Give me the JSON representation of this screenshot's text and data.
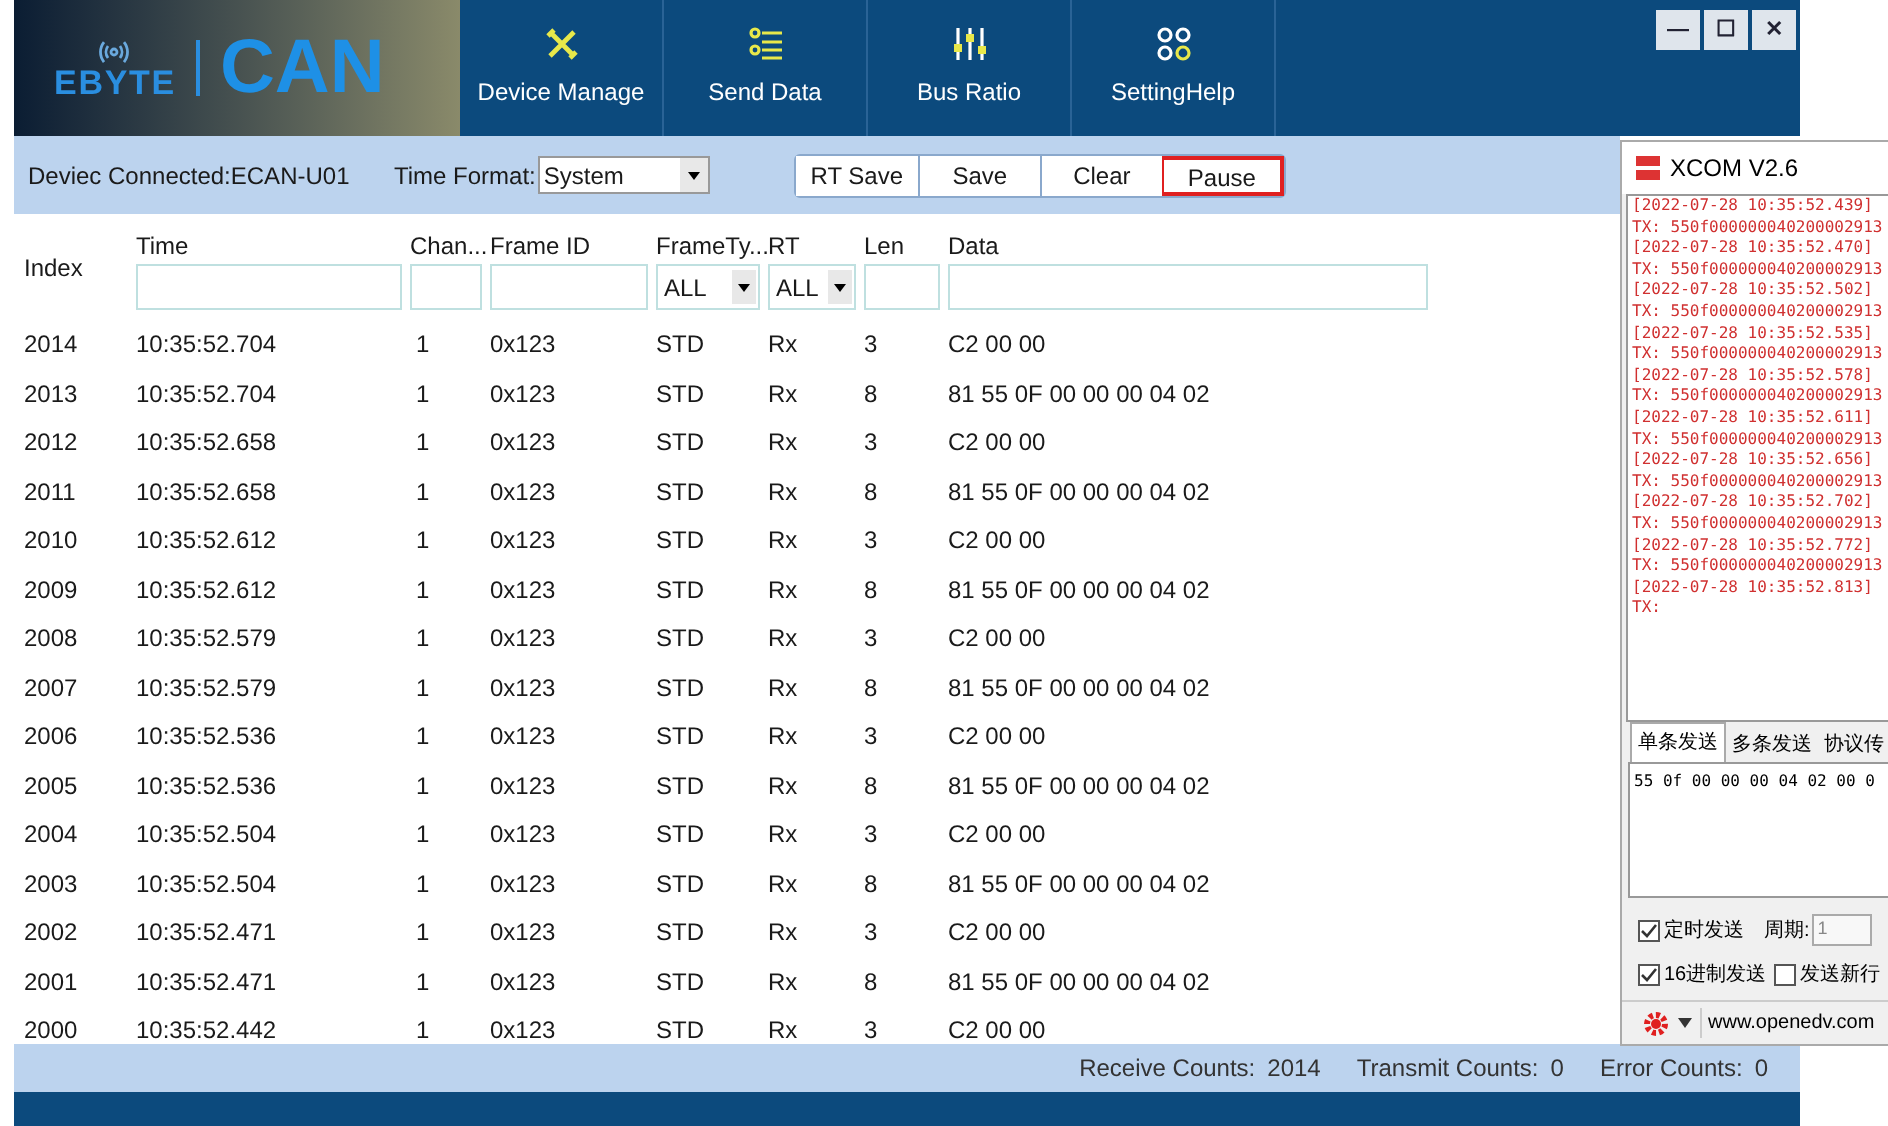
{
  "app": {
    "logo": {
      "brand": "EBYTE",
      "product": "CAN"
    },
    "nav": [
      {
        "label": "Device Manage"
      },
      {
        "label": "Send Data"
      },
      {
        "label": "Bus Ratio"
      },
      {
        "label": "SettingHelp"
      }
    ],
    "window_controls": [
      "—",
      "☐",
      "✕"
    ],
    "toolbar": {
      "connection": "Deviec Connected:ECAN-U01",
      "time_format_label": "Time Format:",
      "time_format_value": "System",
      "buttons": [
        {
          "label": "RT Save",
          "highlighted": false
        },
        {
          "label": "Save",
          "highlighted": false
        },
        {
          "label": "Clear",
          "highlighted": false
        },
        {
          "label": "Pause",
          "highlighted": true
        }
      ]
    },
    "table": {
      "columns": [
        {
          "label": "Index",
          "kind": "plain"
        },
        {
          "label": "Time",
          "kind": "field"
        },
        {
          "label": "Chan...",
          "kind": "field"
        },
        {
          "label": "Frame ID",
          "kind": "field"
        },
        {
          "label": "FrameTy...",
          "kind": "select",
          "value": "ALL"
        },
        {
          "label": "RT",
          "kind": "select",
          "value": "ALL"
        },
        {
          "label": "Len",
          "kind": "field"
        },
        {
          "label": "Data",
          "kind": "field"
        }
      ],
      "rows": [
        [
          "2014",
          "10:35:52.704",
          "1",
          "0x123",
          "STD",
          "Rx",
          "3",
          "C2 00 00"
        ],
        [
          "2013",
          "10:35:52.704",
          "1",
          "0x123",
          "STD",
          "Rx",
          "8",
          "81 55 0F 00 00 00 04 02"
        ],
        [
          "2012",
          "10:35:52.658",
          "1",
          "0x123",
          "STD",
          "Rx",
          "3",
          "C2 00 00"
        ],
        [
          "2011",
          "10:35:52.658",
          "1",
          "0x123",
          "STD",
          "Rx",
          "8",
          "81 55 0F 00 00 00 04 02"
        ],
        [
          "2010",
          "10:35:52.612",
          "1",
          "0x123",
          "STD",
          "Rx",
          "3",
          "C2 00 00"
        ],
        [
          "2009",
          "10:35:52.612",
          "1",
          "0x123",
          "STD",
          "Rx",
          "8",
          "81 55 0F 00 00 00 04 02"
        ],
        [
          "2008",
          "10:35:52.579",
          "1",
          "0x123",
          "STD",
          "Rx",
          "3",
          "C2 00 00"
        ],
        [
          "2007",
          "10:35:52.579",
          "1",
          "0x123",
          "STD",
          "Rx",
          "8",
          "81 55 0F 00 00 00 04 02"
        ],
        [
          "2006",
          "10:35:52.536",
          "1",
          "0x123",
          "STD",
          "Rx",
          "3",
          "C2 00 00"
        ],
        [
          "2005",
          "10:35:52.536",
          "1",
          "0x123",
          "STD",
          "Rx",
          "8",
          "81 55 0F 00 00 00 04 02"
        ],
        [
          "2004",
          "10:35:52.504",
          "1",
          "0x123",
          "STD",
          "Rx",
          "3",
          "C2 00 00"
        ],
        [
          "2003",
          "10:35:52.504",
          "1",
          "0x123",
          "STD",
          "Rx",
          "8",
          "81 55 0F 00 00 00 04 02"
        ],
        [
          "2002",
          "10:35:52.471",
          "1",
          "0x123",
          "STD",
          "Rx",
          "3",
          "C2 00 00"
        ],
        [
          "2001",
          "10:35:52.471",
          "1",
          "0x123",
          "STD",
          "Rx",
          "8",
          "81 55 0F 00 00 00 04 02"
        ],
        [
          "2000",
          "10:35:52.442",
          "1",
          "0x123",
          "STD",
          "Rx",
          "3",
          "C2 00 00"
        ]
      ]
    },
    "status_bar": [
      {
        "label": "Receive Counts:",
        "value": "2014"
      },
      {
        "label": "Transmit Counts:",
        "value": "0"
      },
      {
        "label": "Error Counts:",
        "value": "0"
      }
    ]
  },
  "xcom": {
    "title": "XCOM V2.6",
    "log": [
      "[2022-07-28 10:35:52.439]",
      "TX: 550f000000040200002913",
      "[2022-07-28 10:35:52.470]",
      "TX: 550f000000040200002913",
      "[2022-07-28 10:35:52.502]",
      "TX: 550f000000040200002913",
      "[2022-07-28 10:35:52.535]",
      "TX: 550f000000040200002913",
      "[2022-07-28 10:35:52.578]",
      "TX: 550f000000040200002913",
      "[2022-07-28 10:35:52.611]",
      "TX: 550f000000040200002913",
      "[2022-07-28 10:35:52.656]",
      "TX: 550f000000040200002913",
      "[2022-07-28 10:35:52.702]",
      "TX: 550f000000040200002913",
      "[2022-07-28 10:35:52.772]",
      "TX: 550f000000040200002913",
      "[2022-07-28 10:35:52.813]",
      "TX:"
    ],
    "tabs": [
      {
        "label": "单条发送",
        "selected": true
      },
      {
        "label": "多条发送",
        "selected": false
      },
      {
        "label": "协议传",
        "selected": false
      }
    ],
    "send_text": "55 0f 00 00 00 04 02 00 0",
    "timed_send": {
      "label": "定时发送",
      "checked": true
    },
    "period_label": "周期:",
    "period_value": "1",
    "hex_send": {
      "label": "16进制发送",
      "checked": true
    },
    "newline": {
      "label": "发送新行",
      "checked": false
    },
    "url": "www.openedv.com"
  }
}
